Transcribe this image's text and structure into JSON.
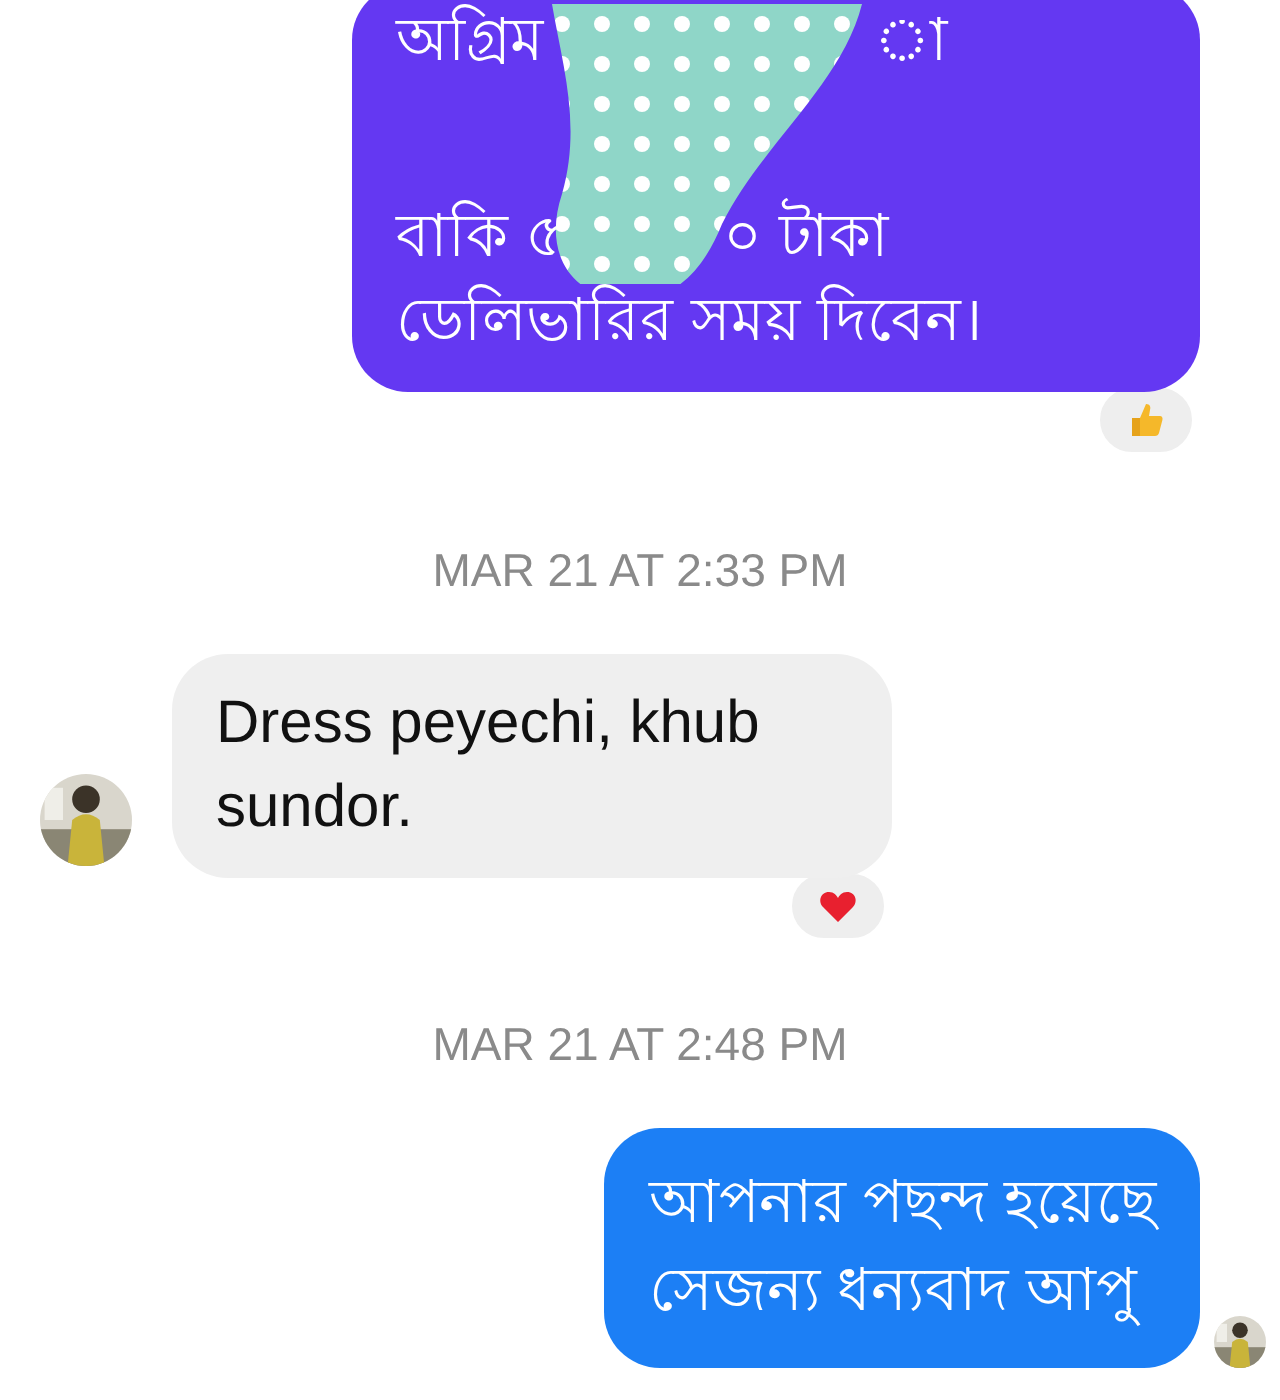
{
  "conversation": [
    {
      "kind": "outgoing",
      "color": "#6438f2",
      "redacted": true,
      "lines": [
        [
          "অগ্রিম",
          "া"
        ],
        [
          "বাকি ৫",
          "০ টাকা"
        ],
        [
          "ডেলিভারির সময় দিবেন।"
        ]
      ],
      "reaction": {
        "kind": "thumbs-up"
      },
      "seen_avatar": false
    },
    {
      "kind": "timestamp",
      "text": "MAR 21 AT 2:33 PM"
    },
    {
      "kind": "incoming",
      "avatar": true,
      "lines": [
        [
          "Dress peyechi, khub"
        ],
        [
          "sundor."
        ]
      ],
      "reaction": {
        "kind": "heart"
      }
    },
    {
      "kind": "timestamp",
      "text": "MAR 21 AT 2:48 PM"
    },
    {
      "kind": "outgoing",
      "color": "#1c7ff5",
      "redacted": false,
      "lines": [
        [
          "আপনার পছন্দ হয়েছে"
        ],
        [
          "সেজন্য ধন্যবাদ আপু"
        ]
      ],
      "seen_avatar": true
    }
  ]
}
